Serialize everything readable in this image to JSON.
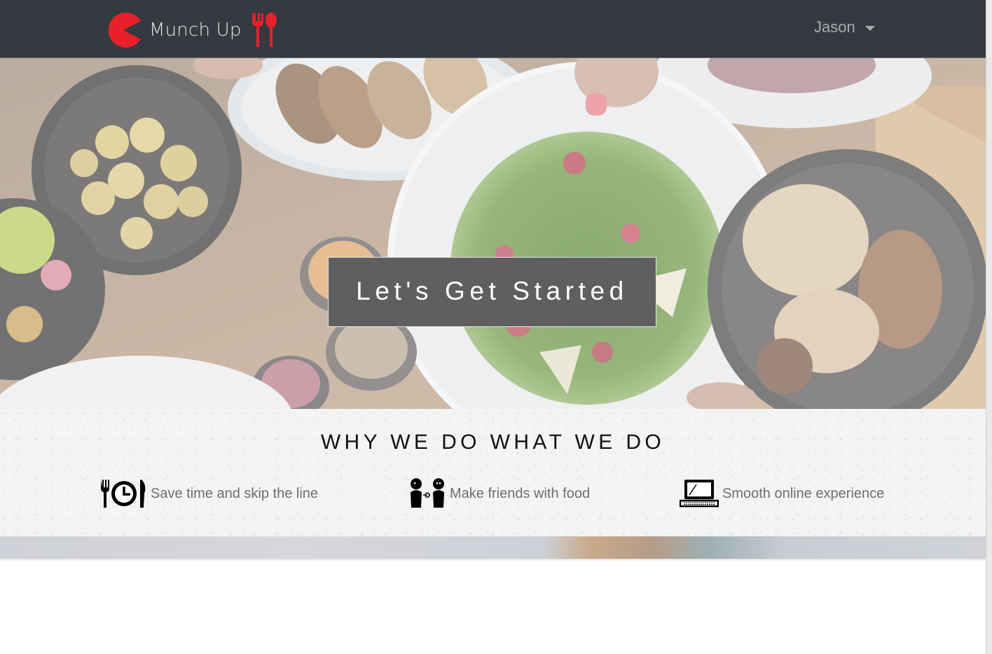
{
  "navbar": {
    "brand_name": "Munch Up",
    "user_name": "Jason",
    "logo_color": "#e8202a",
    "background": "#343a40"
  },
  "hero": {
    "cta_label": "Let's Get Started"
  },
  "why": {
    "title": "WHY WE DO WHAT WE DO",
    "features": [
      {
        "icon": "fork-clock-knife-icon",
        "text": "Save time and skip the line"
      },
      {
        "icon": "friends-icon",
        "text": "Make friends with food"
      },
      {
        "icon": "laptop-icon",
        "text": "Smooth online experience"
      }
    ]
  }
}
